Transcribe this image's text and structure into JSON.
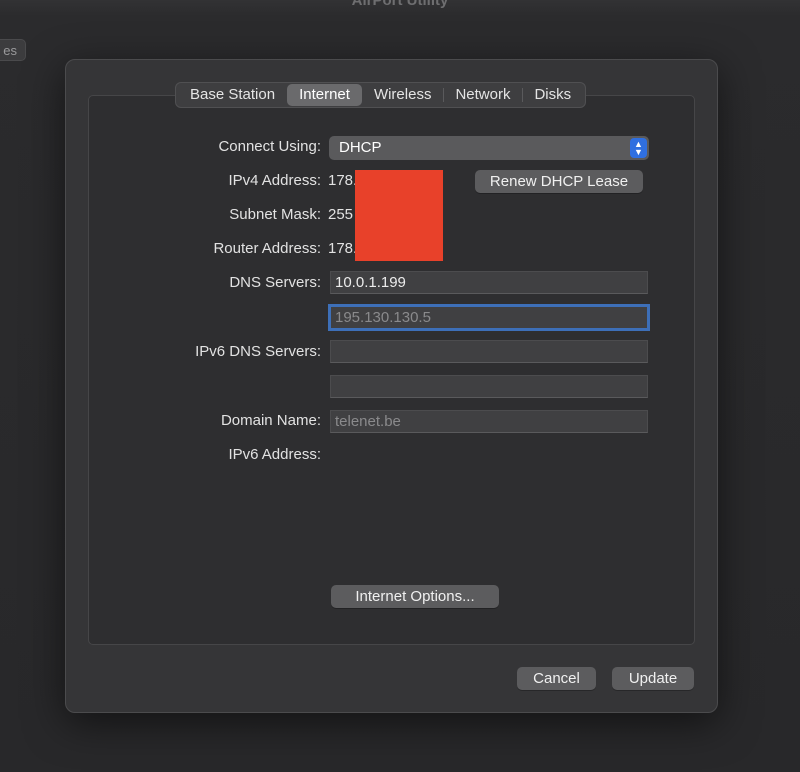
{
  "window": {
    "title": "AirPort Utility",
    "background_button": "es"
  },
  "tabs": [
    {
      "label": "Base Station",
      "selected": false
    },
    {
      "label": "Internet",
      "selected": true
    },
    {
      "label": "Wireless",
      "selected": false
    },
    {
      "label": "Network",
      "selected": false
    },
    {
      "label": "Disks",
      "selected": false
    }
  ],
  "form": {
    "connect_using": {
      "label": "Connect Using:",
      "value": "DHCP"
    },
    "ipv4": {
      "label": "IPv4 Address:",
      "value": "178."
    },
    "subnet": {
      "label": "Subnet Mask:",
      "value": "255"
    },
    "router": {
      "label": "Router Address:",
      "value": "178."
    },
    "renew_button": "Renew DHCP Lease",
    "dns": {
      "label": "DNS Servers:",
      "primary": "10.0.1.199",
      "secondary_placeholder": "195.130.130.5"
    },
    "ipv6_dns": {
      "label": "IPv6 DNS Servers:",
      "primary": "",
      "secondary": ""
    },
    "domain": {
      "label": "Domain Name:",
      "placeholder": "telenet.be"
    },
    "ipv6_address": {
      "label": "IPv6 Address:",
      "value": ""
    },
    "internet_options_button": "Internet Options..."
  },
  "footer": {
    "cancel": "Cancel",
    "update": "Update"
  },
  "colors": {
    "accent": "#2f6fe0",
    "focus_ring": "#3d6fb8",
    "redaction": "#e8412a"
  }
}
